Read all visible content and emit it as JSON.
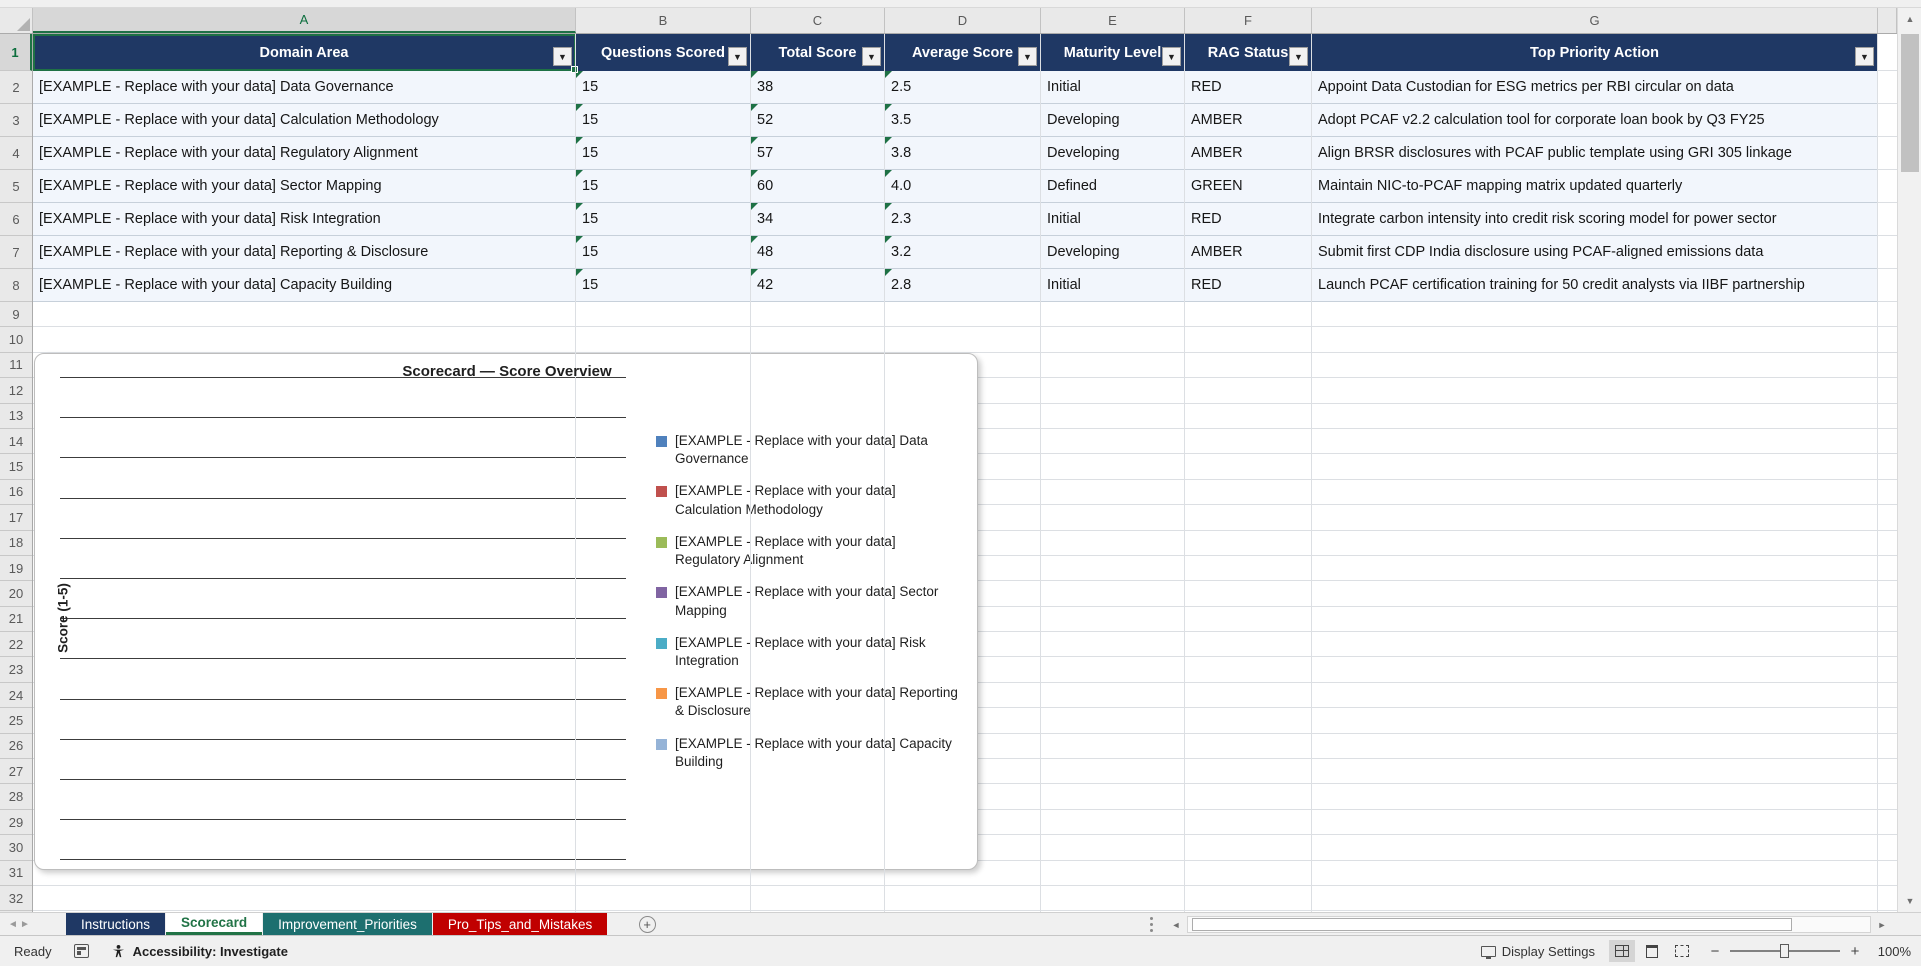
{
  "sheet": {
    "column_letters": [
      "A",
      "B",
      "C",
      "D",
      "E",
      "F",
      "G"
    ],
    "row_numbers": [
      1,
      2,
      3,
      4,
      5,
      6,
      7,
      8,
      9,
      10,
      11,
      12,
      13,
      14,
      15,
      16,
      17,
      18,
      19,
      20,
      21,
      22,
      23,
      24,
      25,
      26,
      27,
      28,
      29,
      30,
      31,
      32
    ],
    "header": [
      "Domain Area",
      "Questions Scored",
      "Total Score",
      "Average Score",
      "Maturity Level",
      "RAG Status",
      "Top Priority Action"
    ],
    "rows": [
      [
        "[EXAMPLE - Replace with your data] Data Governance",
        "15",
        "38",
        "2.5",
        "Initial",
        "RED",
        "Appoint Data Custodian for ESG metrics per RBI circular on data"
      ],
      [
        "[EXAMPLE - Replace with your data] Calculation Methodology",
        "15",
        "52",
        "3.5",
        "Developing",
        "AMBER",
        "Adopt PCAF v2.2 calculation tool for corporate loan book by Q3 FY25"
      ],
      [
        "[EXAMPLE - Replace with your data] Regulatory Alignment",
        "15",
        "57",
        "3.8",
        "Developing",
        "AMBER",
        "Align BRSR disclosures with PCAF public template using GRI 305 linkage"
      ],
      [
        "[EXAMPLE - Replace with your data] Sector Mapping",
        "15",
        "60",
        "4.0",
        "Defined",
        "GREEN",
        "Maintain NIC-to-PCAF mapping matrix updated quarterly"
      ],
      [
        "[EXAMPLE - Replace with your data] Risk Integration",
        "15",
        "34",
        "2.3",
        "Initial",
        "RED",
        "Integrate carbon intensity into credit risk scoring model for power sector"
      ],
      [
        "[EXAMPLE - Replace with your data] Reporting & Disclosure",
        "15",
        "48",
        "3.2",
        "Developing",
        "AMBER",
        "Submit first CDP India disclosure using PCAF-aligned emissions data"
      ],
      [
        "[EXAMPLE - Replace with your data] Capacity Building",
        "15",
        "42",
        "2.8",
        "Initial",
        "RED",
        "Launch PCAF certification training for 50 credit analysts via IIBF partnership"
      ]
    ]
  },
  "chart": {
    "type": "bar",
    "title": "Scorecard — Score Overview",
    "ylabel": "Score (1-5)",
    "values_rendered": false,
    "gridline_count": 13,
    "legend_position": "right",
    "legend": [
      {
        "label": "[EXAMPLE - Replace with your data] Data Governance",
        "color": "#4F81BD"
      },
      {
        "label": "[EXAMPLE - Replace with your data] Calculation Methodology",
        "color": "#C0504D"
      },
      {
        "label": "[EXAMPLE - Replace with your data] Regulatory Alignment",
        "color": "#9BBB59"
      },
      {
        "label": "[EXAMPLE - Replace with your data] Sector Mapping",
        "color": "#8064A2"
      },
      {
        "label": "[EXAMPLE - Replace with your data] Risk Integration",
        "color": "#4BACC6"
      },
      {
        "label": "[EXAMPLE - Replace with your data] Reporting & Disclosure",
        "color": "#F79646"
      },
      {
        "label": "[EXAMPLE - Replace with your data] Capacity Building",
        "color": "#95B3D7"
      }
    ]
  },
  "tabs": [
    {
      "label": "Instructions",
      "color": "#1F3864",
      "active": false
    },
    {
      "label": "Scorecard",
      "color": "#FFFFFF",
      "active": true
    },
    {
      "label": "Improvement_Priorities",
      "color": "#1D6F6F",
      "active": false
    },
    {
      "label": "Pro_Tips_and_Mistakes",
      "color": "#C00000",
      "active": false
    }
  ],
  "status_bar": {
    "ready": "Ready",
    "accessibility": "Accessibility: Investigate",
    "display_settings": "Display Settings",
    "zoom_percent": "100%"
  },
  "icons": {
    "filter_arrow": "▼",
    "scroll_up": "▲",
    "scroll_down": "▼",
    "scroll_left": "◄",
    "scroll_right": "►",
    "tab_nav_left": "◄",
    "tab_nav_right": "►",
    "add_sheet": "+",
    "zoom_out": "−",
    "zoom_in": "+"
  },
  "colors": {
    "table_header_fill": "#1F3864",
    "table_row_fill": "#F2F6FC",
    "selection_green": "#1E7145",
    "active_tab_text": "#217346"
  }
}
